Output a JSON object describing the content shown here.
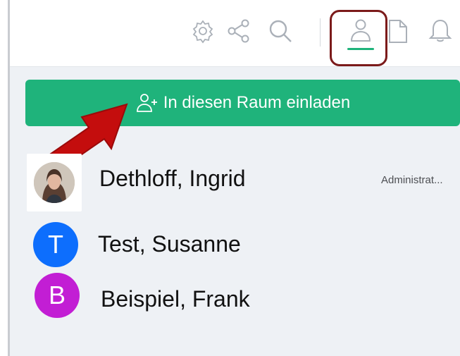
{
  "toolbar": {
    "icons": [
      "gear-icon",
      "share-icon",
      "search-icon",
      "user-icon",
      "document-icon",
      "bell-icon"
    ],
    "active_tab": "user-icon",
    "accent_color": "#1fb37b",
    "highlight_color": "#7b1a1a"
  },
  "invite": {
    "label": "In diesen Raum einladen",
    "icon": "add-user-icon",
    "color": "#1fb37b"
  },
  "annotation": {
    "arrow_color": "#c40d0d"
  },
  "members": [
    {
      "name": "Dethloff, Ingrid",
      "role": "Administrat...",
      "avatar": "photo"
    },
    {
      "name": "Test, Susanne",
      "initial": "T",
      "color": "#0d6efd"
    },
    {
      "name": "Beispiel, Frank",
      "initial": "B",
      "color": "#c21ed4"
    }
  ]
}
